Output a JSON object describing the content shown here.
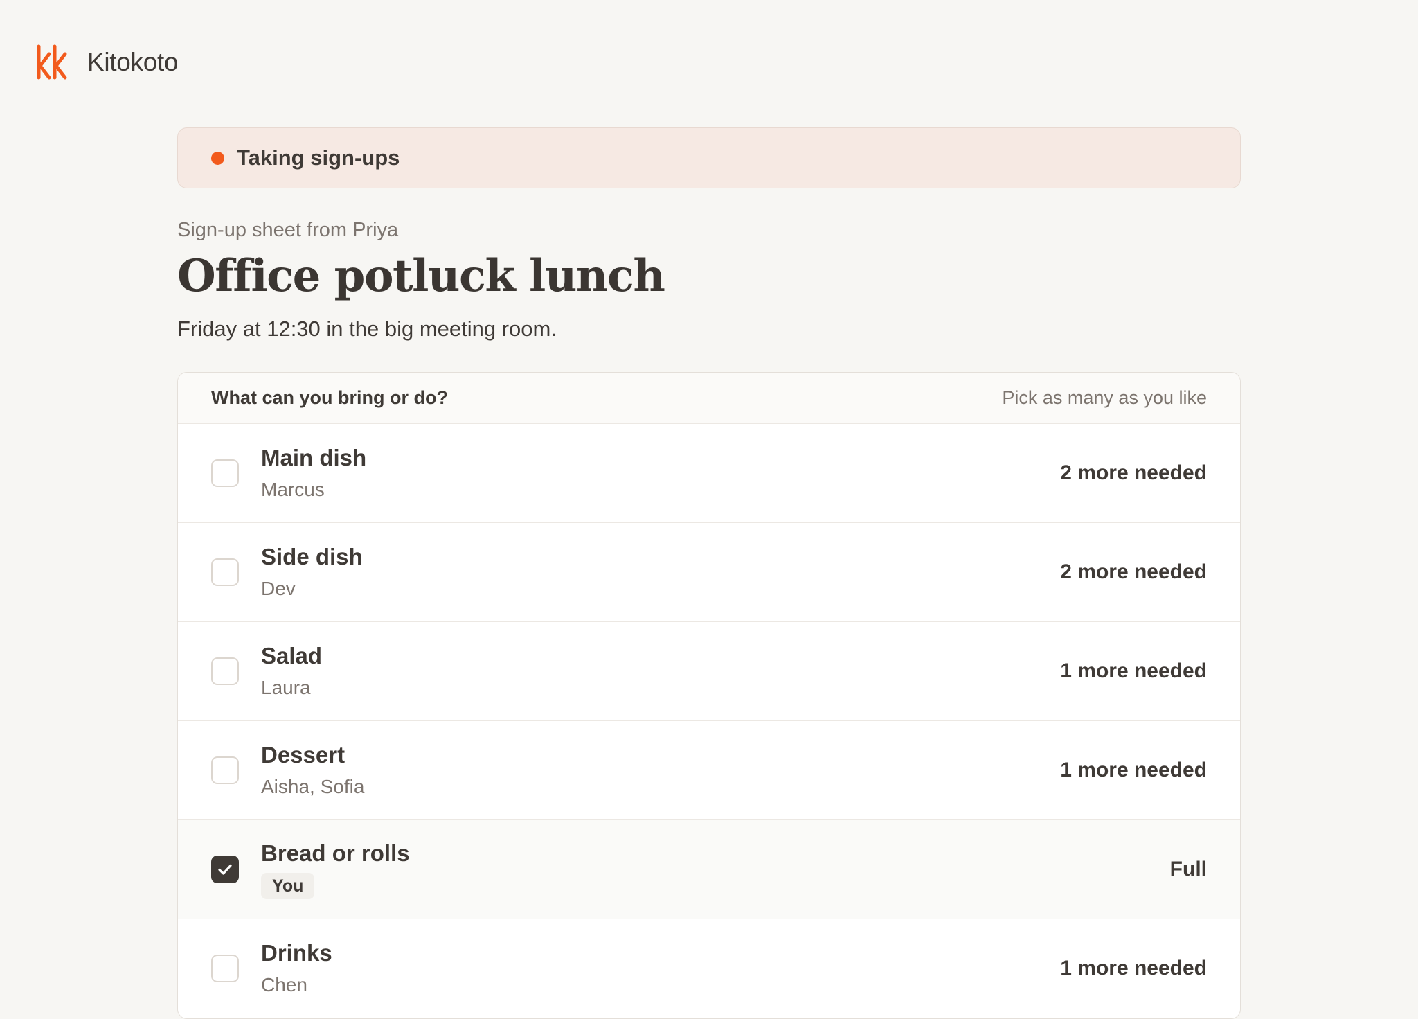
{
  "brand": {
    "name": "Kitokoto",
    "logo_icon": "kk-logo-icon",
    "accent": "#f25a1c"
  },
  "status": {
    "label": "Taking sign-ups",
    "dot_color": "#f25a1c"
  },
  "sheet": {
    "from": "Sign-up sheet from Priya",
    "title": "Office potluck lunch",
    "description": "Friday at 12:30 in the big meeting room."
  },
  "list": {
    "question": "What can you bring or do?",
    "hint": "Pick as many as you like",
    "items": [
      {
        "name": "Main dish",
        "people": "Marcus",
        "status": "2 more needed",
        "checked": false
      },
      {
        "name": "Side dish",
        "people": "Dev",
        "status": "2 more needed",
        "checked": false
      },
      {
        "name": "Salad",
        "people": "Laura",
        "status": "1 more needed",
        "checked": false
      },
      {
        "name": "Dessert",
        "people": "Aisha, Sofia",
        "status": "1 more needed",
        "checked": false
      },
      {
        "name": "Bread or rolls",
        "badge": "You",
        "status": "Full",
        "checked": true
      },
      {
        "name": "Drinks",
        "people": "Chen",
        "status": "1 more needed",
        "checked": false
      }
    ]
  }
}
